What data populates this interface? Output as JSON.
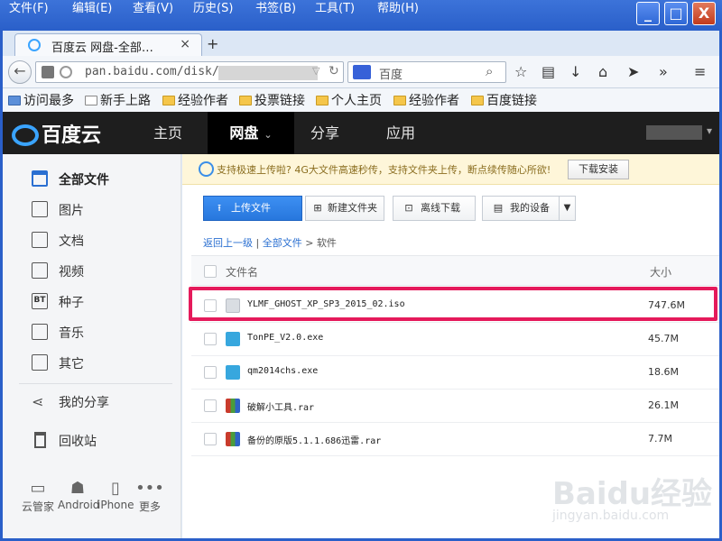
{
  "menubar": {
    "items": [
      "文件(F)",
      "编辑(E)",
      "查看(V)",
      "历史(S)",
      "书签(B)",
      "工具(T)",
      "帮助(H)"
    ]
  },
  "window_controls": {
    "minimize": "_",
    "maximize": "□",
    "close": "X"
  },
  "tab": {
    "title": "百度云 网盘-全部…",
    "close": "×",
    "new_tab": "+"
  },
  "navbar": {
    "url": "pan.baidu.com/disk/",
    "search_placeholder": "百度"
  },
  "bookmarks": [
    "访问最多",
    "新手上路",
    "经验作者",
    "投票链接",
    "个人主页",
    "经验作者",
    "百度链接"
  ],
  "header": {
    "logo": "百度云",
    "nav": [
      "主页",
      "网盘",
      "分享",
      "应用"
    ],
    "active": "网盘"
  },
  "sidebar": {
    "items": [
      {
        "label": "全部文件",
        "icon": "folder-icon"
      },
      {
        "label": "图片",
        "icon": "image-icon"
      },
      {
        "label": "文档",
        "icon": "document-icon"
      },
      {
        "label": "视频",
        "icon": "video-icon"
      },
      {
        "label": "种子",
        "icon": "bt-icon"
      },
      {
        "label": "音乐",
        "icon": "music-icon"
      },
      {
        "label": "其它",
        "icon": "more-icon"
      },
      {
        "label": "我的分享",
        "icon": "share-icon"
      },
      {
        "label": "回收站",
        "icon": "trash-icon"
      }
    ],
    "devices": [
      "云管家",
      "Android",
      "iPhone",
      "更多"
    ],
    "bt_icon_text": "BT"
  },
  "notice": {
    "text": "支持极速上传啦? 4G大文件高速秒传，支持文件夹上传，断点续传随心所欲!",
    "button": "下载安装"
  },
  "toolbar": {
    "upload": "上传文件",
    "new_folder": "新建文件夹",
    "offline": "离线下载",
    "devices": "我的设备"
  },
  "breadcrumb": {
    "back": "返回上一级",
    "sep": "|",
    "all": "全部文件",
    "arrow": ">",
    "current": "软件"
  },
  "table": {
    "col_name": "文件名",
    "col_size": "大小",
    "rows": [
      {
        "name": "YLMF_GHOST_XP_SP3_2015_02.iso",
        "size": "747.6M",
        "type": "iso"
      },
      {
        "name": "TonPE_V2.0.exe",
        "size": "45.7M",
        "type": "exe"
      },
      {
        "name": "qm2014chs.exe",
        "size": "18.6M",
        "type": "exe"
      },
      {
        "name": "破解小工具.rar",
        "size": "26.1M",
        "type": "rar"
      },
      {
        "name": "备份的原版5.1.1.686迅雷.rar",
        "size": "7.7M",
        "type": "rar"
      }
    ]
  },
  "watermark": {
    "main": "Baidu经验",
    "sub": "jingyan.baidu.com"
  },
  "colors": {
    "accent": "#2777dd",
    "highlight": "#e51a5b",
    "header_bg": "#1e1e1e"
  }
}
